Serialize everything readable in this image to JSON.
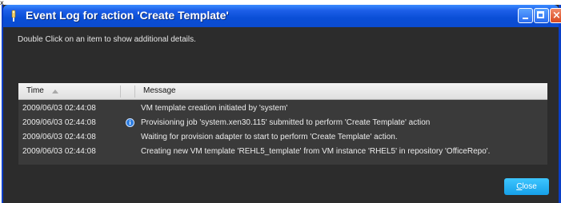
{
  "corner_mark": "x",
  "window": {
    "title": "Event Log for action 'Create Template'"
  },
  "instructions": "Double Click on an item to show additional details.",
  "table": {
    "columns": {
      "time": "Time",
      "message": "Message"
    },
    "sort": {
      "column": "time",
      "direction": "ascending"
    },
    "rows": [
      {
        "time": "2009/06/03 02:44:08",
        "message": "VM template creation initiated by 'system'",
        "icon": ""
      },
      {
        "time": "2009/06/03 02:44:08",
        "message": "Provisioning job 'system.xen30.115' submitted to perform 'Create Template' action",
        "icon": "info-icon"
      },
      {
        "time": "2009/06/03 02:44:08",
        "message": "Waiting for provision adapter to start to perform 'Create Template' action.",
        "icon": ""
      },
      {
        "time": "2009/06/03 02:44:08",
        "message": "Creating new VM template 'REHL5_template' from VM instance 'RHEL5' in repository 'OfficeRepo'.",
        "icon": ""
      }
    ]
  },
  "close_button": {
    "mnemonic": "C",
    "rest": "lose"
  },
  "colors": {
    "titlebar": "#0a4ed6",
    "window_bg": "#2c2c2c",
    "table_bg": "#3a3a3a",
    "close_button": "#16a0e8"
  }
}
